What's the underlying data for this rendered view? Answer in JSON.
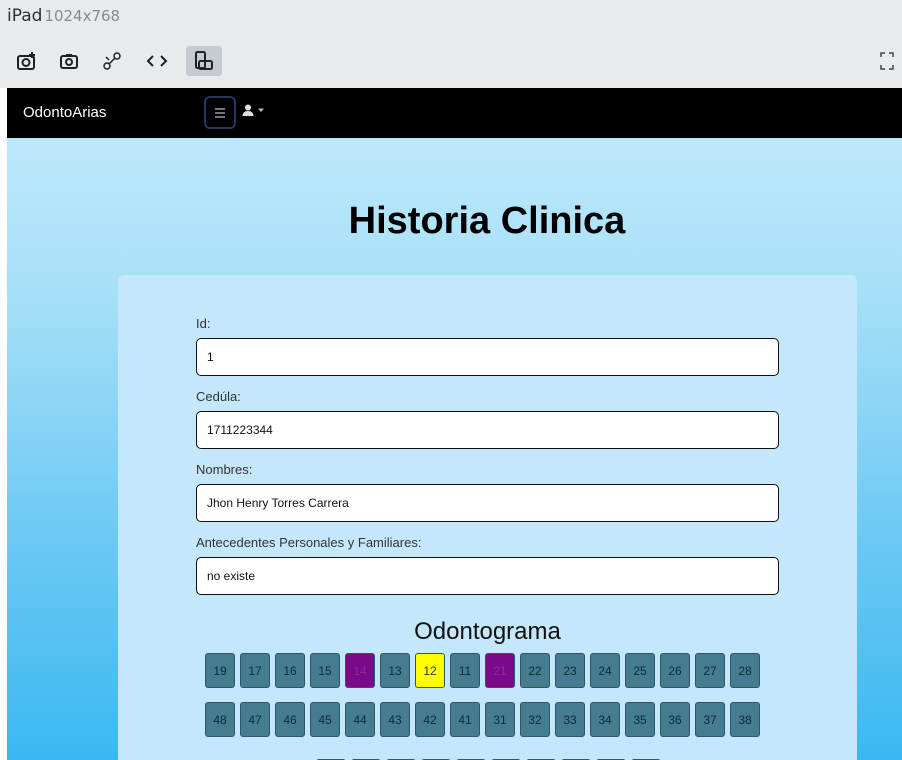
{
  "devtools": {
    "device_name": "iPad",
    "device_size": "1024x768",
    "tools": [
      "screenshot-icon",
      "camera-icon",
      "network-icon",
      "code-icon",
      "rotate-icon"
    ],
    "fullscreen_icon": "expand-icon"
  },
  "navbar": {
    "brand": "OdontoArias",
    "toggler_icon": "hamburger-icon",
    "user_icon": "user-icon"
  },
  "page": {
    "title": "Historia Clinica"
  },
  "form": {
    "fields": [
      {
        "label": "Id:",
        "value": "1"
      },
      {
        "label": "Cedúla:",
        "value": "1711223344"
      },
      {
        "label": "Nombres:",
        "value": "Jhon Henry Torres Carrera"
      },
      {
        "label": "Antecedentes Personales y Familiares:",
        "value": "no existe"
      }
    ]
  },
  "odontograma": {
    "title": "Odontograma",
    "upper_row": [
      {
        "n": "19",
        "state": "normal"
      },
      {
        "n": "17",
        "state": "normal"
      },
      {
        "n": "16",
        "state": "normal"
      },
      {
        "n": "15",
        "state": "normal"
      },
      {
        "n": "14",
        "state": "purple"
      },
      {
        "n": "13",
        "state": "normal"
      },
      {
        "n": "12",
        "state": "yellow"
      },
      {
        "n": "11",
        "state": "normal"
      },
      {
        "n": "21",
        "state": "purple"
      },
      {
        "n": "22",
        "state": "normal"
      },
      {
        "n": "23",
        "state": "normal"
      },
      {
        "n": "24",
        "state": "normal"
      },
      {
        "n": "25",
        "state": "normal"
      },
      {
        "n": "26",
        "state": "normal"
      },
      {
        "n": "27",
        "state": "normal"
      },
      {
        "n": "28",
        "state": "normal"
      }
    ],
    "lower_row": [
      "48",
      "47",
      "46",
      "45",
      "44",
      "43",
      "42",
      "41",
      "31",
      "32",
      "33",
      "34",
      "35",
      "36",
      "37",
      "38"
    ],
    "colors": {
      "normal": "#457c90",
      "purple": "#7a0a8a",
      "yellow": "#ffff00"
    }
  }
}
